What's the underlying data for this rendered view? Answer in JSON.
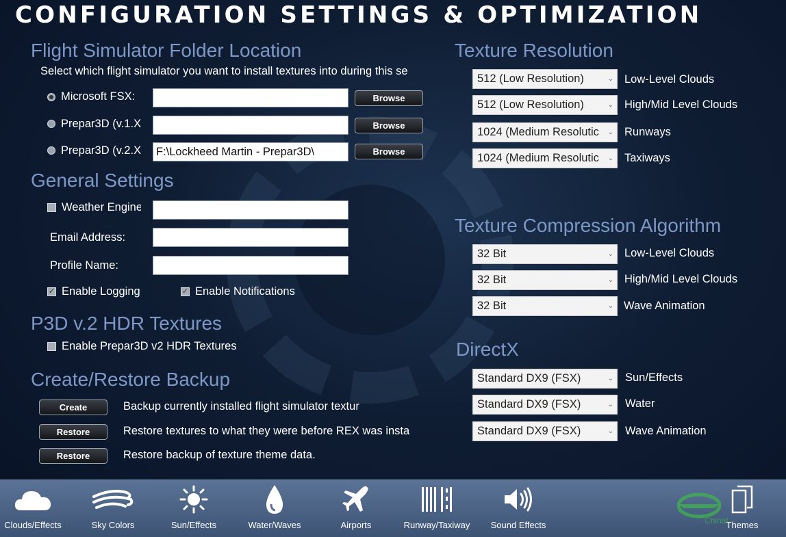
{
  "title": "CONFIGURATION SETTINGS & OPTIMIZATION",
  "folder": {
    "heading": "Flight Simulator Folder Location",
    "instruction": "Select which flight simulator you want to install textures into during this se",
    "rows": [
      {
        "label": "Microsoft FSX:",
        "value": "",
        "button": "Browse",
        "selected": true
      },
      {
        "label": "Prepar3D (v.1.X",
        "value": "",
        "button": "Browse",
        "selected": false
      },
      {
        "label": "Prepar3D (v.2.X",
        "value": "F:\\Lockheed Martin - Prepar3D\\",
        "button": "Browse",
        "selected": false
      }
    ]
  },
  "general": {
    "heading": "General Settings",
    "weather_label": "Weather Engine",
    "weather_value": "",
    "email_label": "Email Address:",
    "email_value": "",
    "profile_label": "Profile Name:",
    "profile_value": "",
    "logging_label": "Enable Logging",
    "notifications_label": "Enable Notifications"
  },
  "hdr": {
    "heading": "P3D v.2 HDR Textures",
    "checkbox_label": "Enable Prepar3D v2 HDR Textures"
  },
  "backup": {
    "heading": "Create/Restore Backup",
    "rows": [
      {
        "button": "Create",
        "text": "Backup currently installed flight simulator textur"
      },
      {
        "button": "Restore",
        "text": "Restore textures to what they were before REX was insta"
      },
      {
        "button": "Restore",
        "text": "Restore backup of texture theme data."
      }
    ]
  },
  "texture_resolution": {
    "heading": "Texture Resolution",
    "rows": [
      {
        "value": "512 (Low Resolution)",
        "label": "Low-Level Clouds"
      },
      {
        "value": "512 (Low Resolution)",
        "label": "High/Mid Level Clouds"
      },
      {
        "value": "1024 (Medium Resolutic",
        "label": "Runways"
      },
      {
        "value": "1024 (Medium Resolutic",
        "label": "Taxiways"
      }
    ]
  },
  "compression": {
    "heading": "Texture Compression Algorithm",
    "rows": [
      {
        "value": "32 Bit",
        "label": "Low-Level Clouds"
      },
      {
        "value": "32 Bit",
        "label": "High/Mid Level Clouds"
      },
      {
        "value": "32 Bit",
        "label": "Wave Animation"
      }
    ]
  },
  "directx": {
    "heading": "DirectX",
    "rows": [
      {
        "value": "Standard DX9 (FSX)",
        "label": "Sun/Effects"
      },
      {
        "value": "Standard DX9 (FSX)",
        "label": "Water"
      },
      {
        "value": "Standard DX9 (FSX)",
        "label": "Wave Animation"
      }
    ]
  },
  "nav": [
    {
      "label": "Clouds/Effects",
      "icon": "cloud-icon"
    },
    {
      "label": "Sky Colors",
      "icon": "wind-icon"
    },
    {
      "label": "Sun/Effects",
      "icon": "sun-icon"
    },
    {
      "label": "Water/Waves",
      "icon": "water-drop-icon"
    },
    {
      "label": "Airports",
      "icon": "airplane-icon"
    },
    {
      "label": "Runway/Taxiway",
      "icon": "runway-icon"
    },
    {
      "label": "Sound Effects",
      "icon": "speaker-icon"
    },
    {
      "label": "Themes",
      "icon": "document-icon"
    }
  ],
  "watermark": "Chinaflier"
}
